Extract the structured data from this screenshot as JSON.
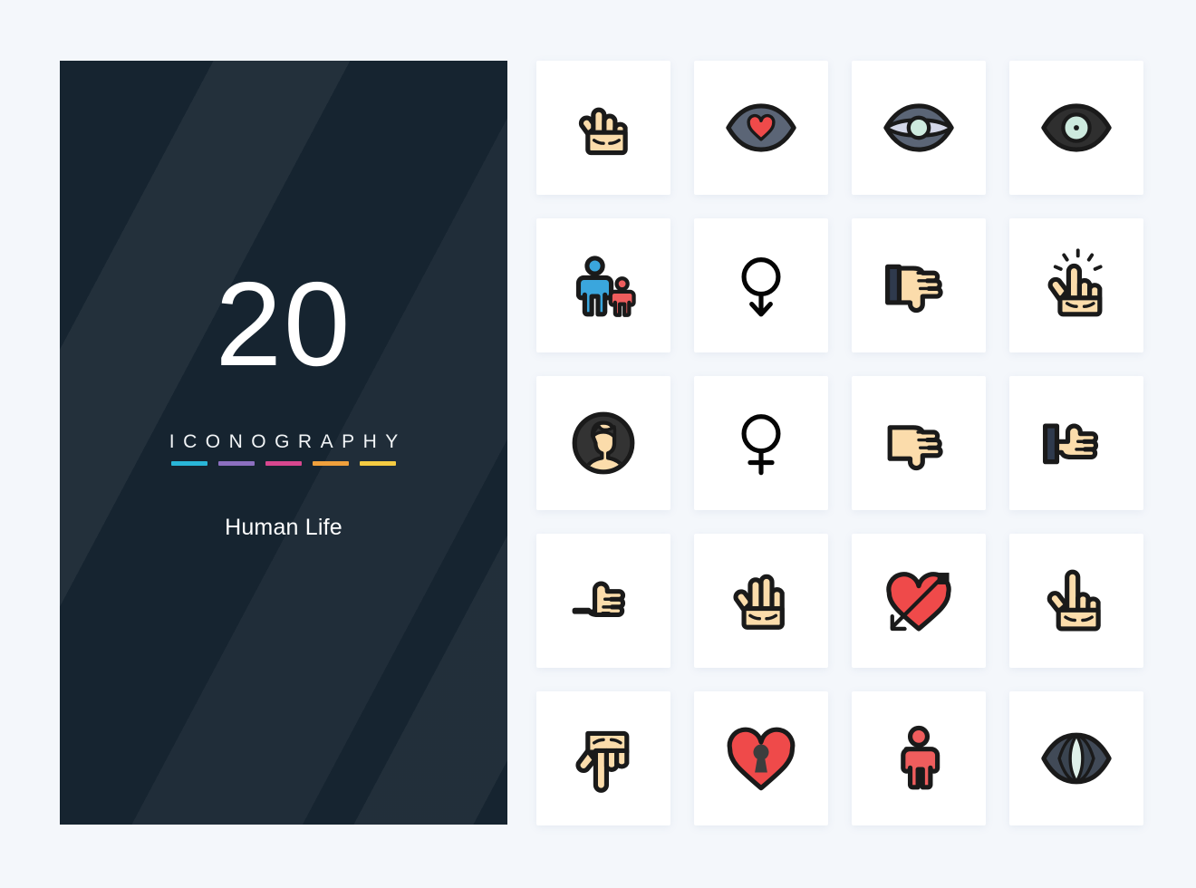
{
  "background_color": "#f4f7fb",
  "cover": {
    "panel_color": "#162430",
    "count": "20",
    "brand": "ICONOGRAPHY",
    "subtitle": "Human Life",
    "accent_bars": [
      {
        "name": "bar-cyan",
        "color": "#29b6d8"
      },
      {
        "name": "bar-purple",
        "color": "#8c6fc0"
      },
      {
        "name": "bar-pink",
        "color": "#d8478f"
      },
      {
        "name": "bar-orange",
        "color": "#f0a03c"
      },
      {
        "name": "bar-yellow",
        "color": "#f5cb42"
      }
    ]
  },
  "palette": {
    "outline": "#1a1a1a",
    "skin": "#fbdcab",
    "red": "#ef4a4a",
    "blue": "#3aa6dd",
    "dark_slate": "#313d4c",
    "gray_eye": "#5b6576",
    "mint": "#cdeade",
    "lavender": "#d3d7e8",
    "cuff": "#2f3a4d",
    "avatar_dark": "#333333"
  },
  "grid": {
    "columns": 4,
    "rows": 5,
    "cell_bg": "#ffffff",
    "icons": [
      {
        "id": "two-finger-hand-icon",
        "label": "Two Finger Hand"
      },
      {
        "id": "eye-heart-icon",
        "label": "Eye Love"
      },
      {
        "id": "eye-open-wide-icon",
        "label": "Eye Open"
      },
      {
        "id": "eye-pupil-icon",
        "label": "Eye Pupil"
      },
      {
        "id": "parent-child-icon",
        "label": "Parent And Child"
      },
      {
        "id": "gender-down-arrow-icon",
        "label": "Gender Down"
      },
      {
        "id": "hand-point-right-cuff-down-icon",
        "label": "Point Right Cuffed"
      },
      {
        "id": "hand-tap-click-icon",
        "label": "Tap Click"
      },
      {
        "id": "avatar-user-icon",
        "label": "User Avatar"
      },
      {
        "id": "female-gender-icon",
        "label": "Female"
      },
      {
        "id": "hand-point-right-thumbdown-icon",
        "label": "Point Right"
      },
      {
        "id": "hand-point-right-thumbup-cuff-icon",
        "label": "Point Right Up Cuffed"
      },
      {
        "id": "hand-point-right-thumbup-icon",
        "label": "Point Right Thumb Up"
      },
      {
        "id": "open-palm-hand-icon",
        "label": "Open Palm"
      },
      {
        "id": "heart-arrow-icon",
        "label": "Heart Arrow"
      },
      {
        "id": "hand-point-up-icon",
        "label": "Point Up"
      },
      {
        "id": "hand-point-down-icon",
        "label": "Point Down"
      },
      {
        "id": "heart-keyhole-icon",
        "label": "Heart Lock"
      },
      {
        "id": "person-body-icon",
        "label": "Person"
      },
      {
        "id": "cat-eye-icon",
        "label": "Cat Eye"
      }
    ]
  }
}
